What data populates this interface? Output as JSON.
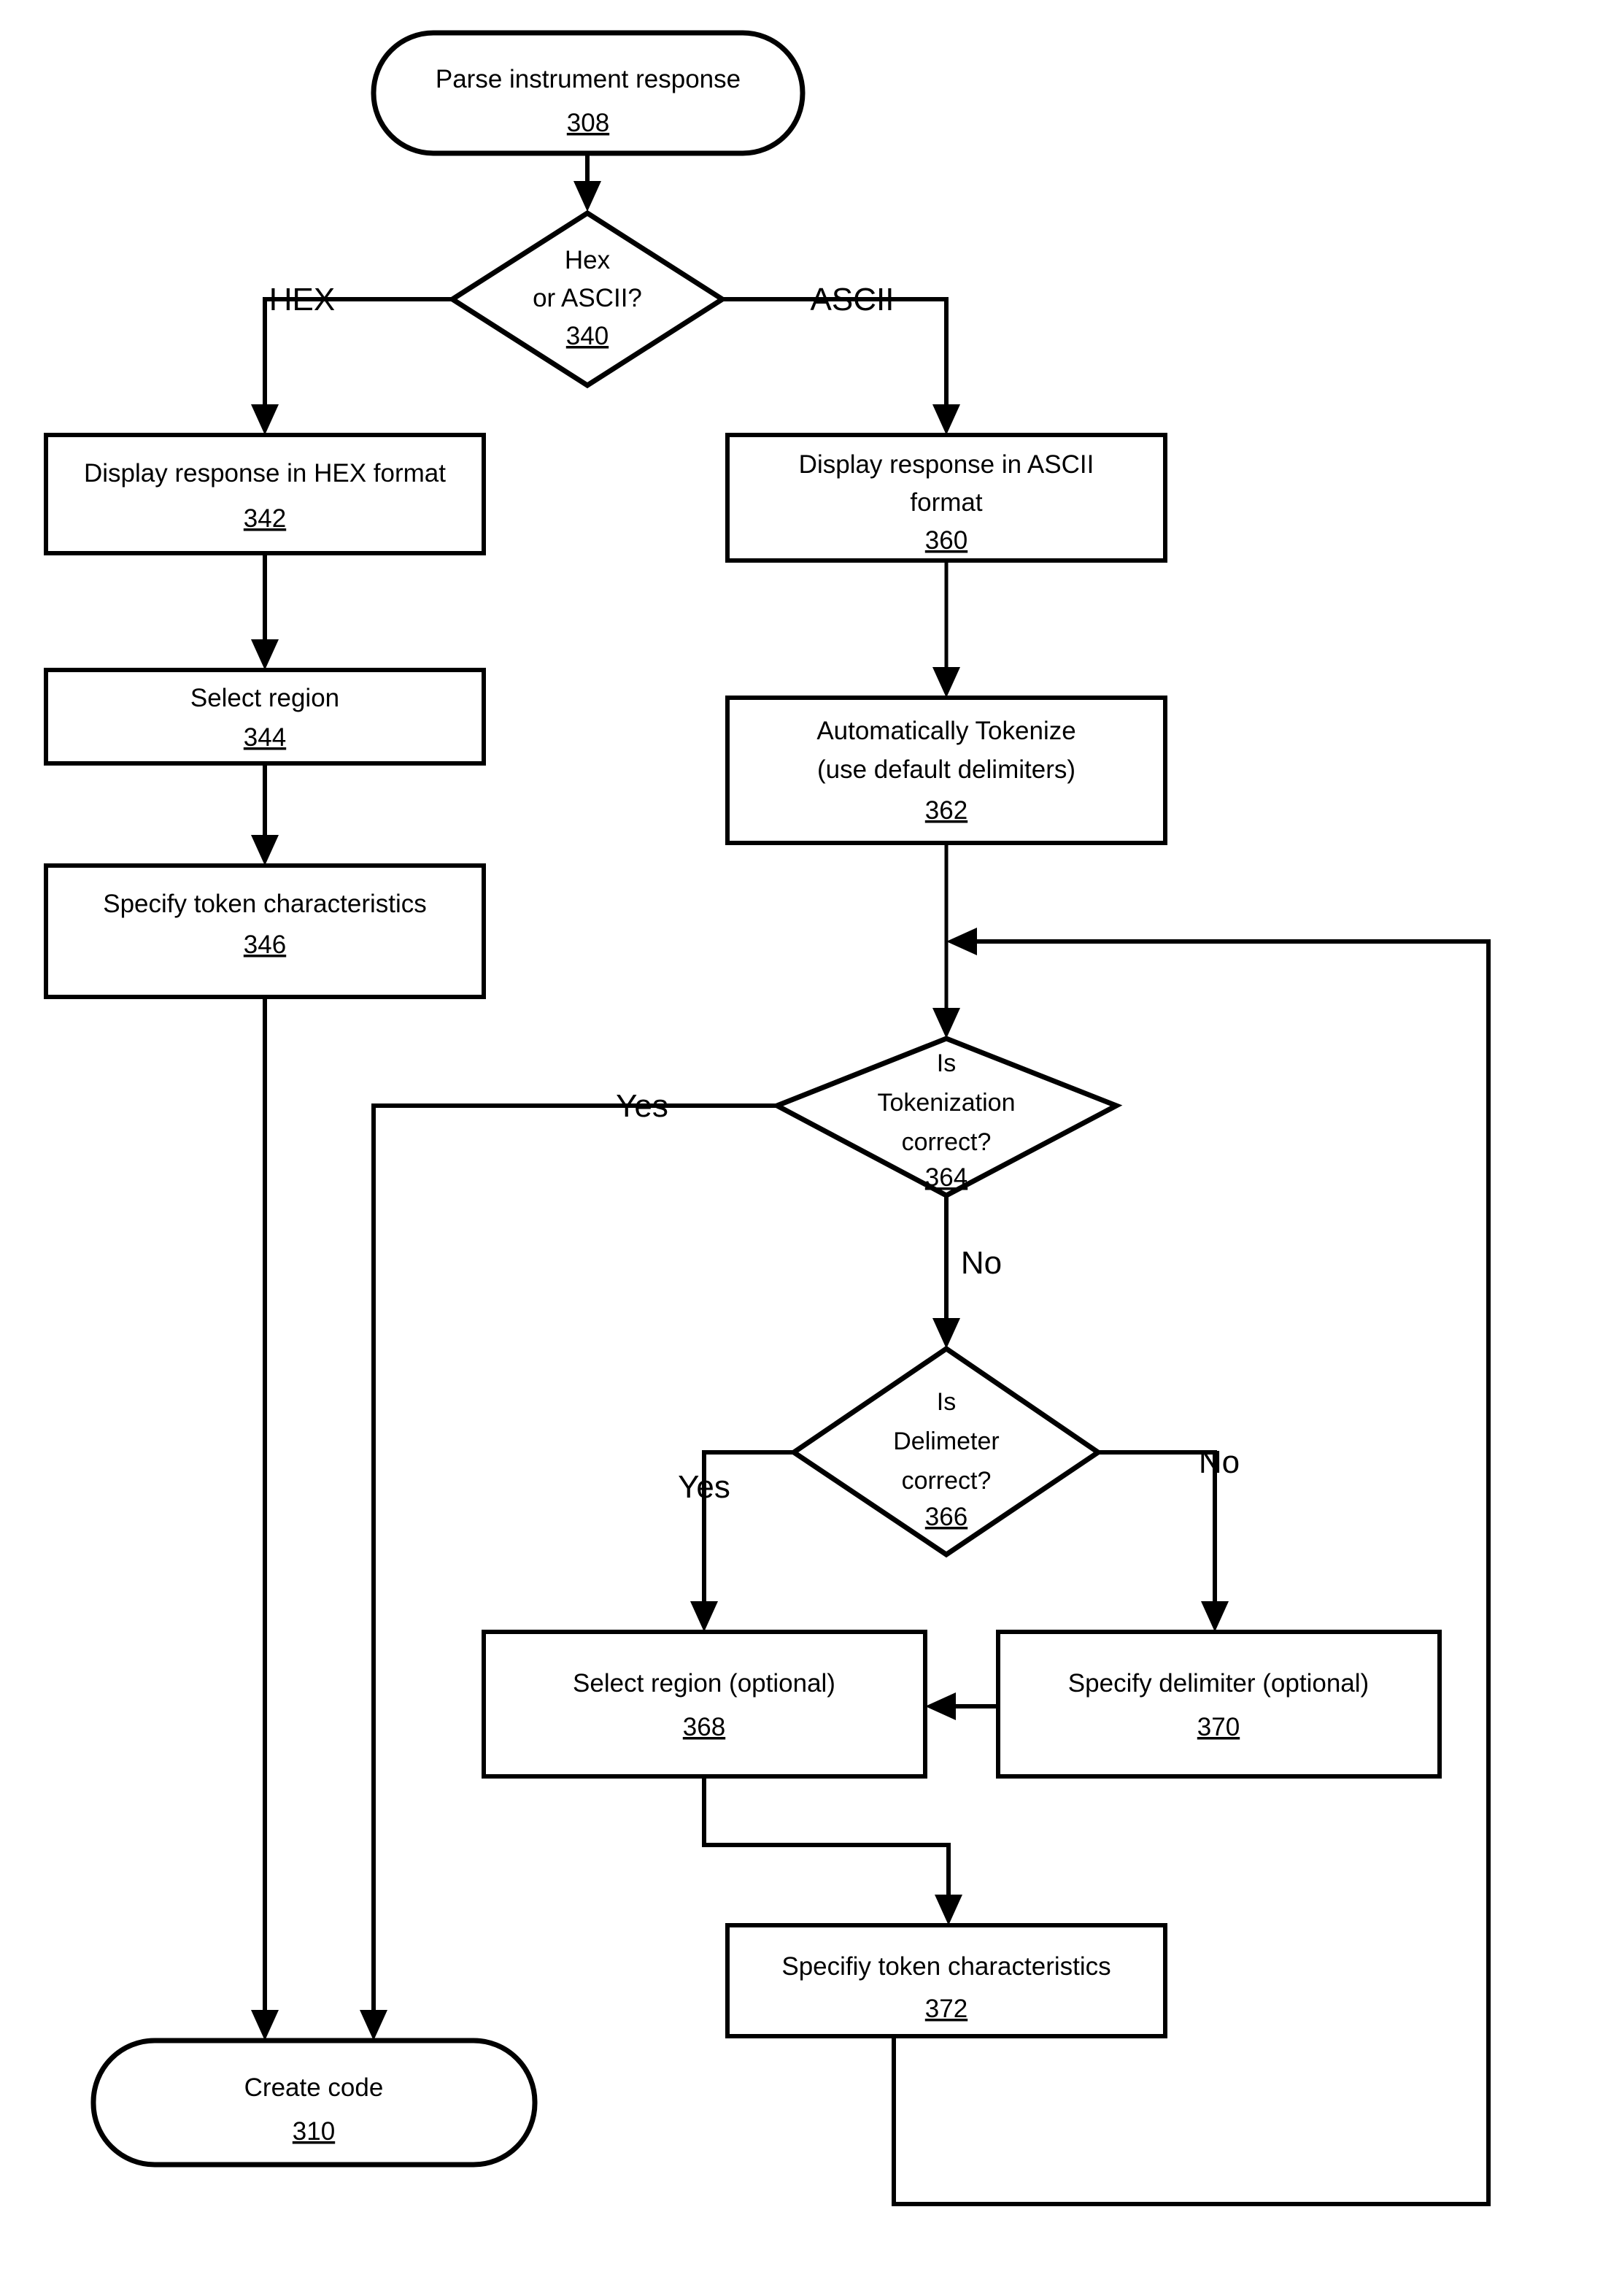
{
  "diagram": {
    "type": "flowchart",
    "title": "Parse instrument response flowchart",
    "nodes": {
      "start_308": {
        "shape": "terminal",
        "lines": [
          "Parse instrument response"
        ],
        "ref": "308"
      },
      "decision_340": {
        "shape": "decision",
        "lines": [
          "Hex",
          "or ASCII?"
        ],
        "ref": "340"
      },
      "process_342": {
        "shape": "process",
        "lines": [
          "Display response in HEX format"
        ],
        "ref": "342"
      },
      "process_344": {
        "shape": "process",
        "lines": [
          "Select region"
        ],
        "ref": "344"
      },
      "process_346": {
        "shape": "process",
        "lines": [
          "Specify token characteristics"
        ],
        "ref": "346"
      },
      "process_360": {
        "shape": "process",
        "lines": [
          "Display response in ASCII",
          "format"
        ],
        "ref": "360"
      },
      "process_362": {
        "shape": "process",
        "lines": [
          "Automatically Tokenize",
          "(use default delimiters)"
        ],
        "ref": "362"
      },
      "decision_364": {
        "shape": "decision",
        "lines": [
          "Is",
          "Tokenization",
          "correct?"
        ],
        "ref": "364"
      },
      "decision_366": {
        "shape": "decision",
        "lines": [
          "Is",
          "Delimeter",
          "correct?"
        ],
        "ref": "366"
      },
      "process_368": {
        "shape": "process",
        "lines": [
          "Select region (optional)"
        ],
        "ref": "368"
      },
      "process_370": {
        "shape": "process",
        "lines": [
          "Specify delimiter (optional)"
        ],
        "ref": "370"
      },
      "process_372": {
        "shape": "process",
        "lines": [
          "Specifiy token characteristics"
        ],
        "ref": "372"
      },
      "end_310": {
        "shape": "terminal",
        "lines": [
          "Create code"
        ],
        "ref": "310"
      }
    },
    "edge_labels": {
      "hex": "HEX",
      "ascii": "ASCII",
      "tokenization_yes": "Yes",
      "tokenization_no": "No",
      "delimiter_yes": "Yes",
      "delimiter_no": "No"
    },
    "colors": {
      "stroke": "#000000",
      "fill": "#ffffff",
      "background": "#ffffff"
    }
  }
}
